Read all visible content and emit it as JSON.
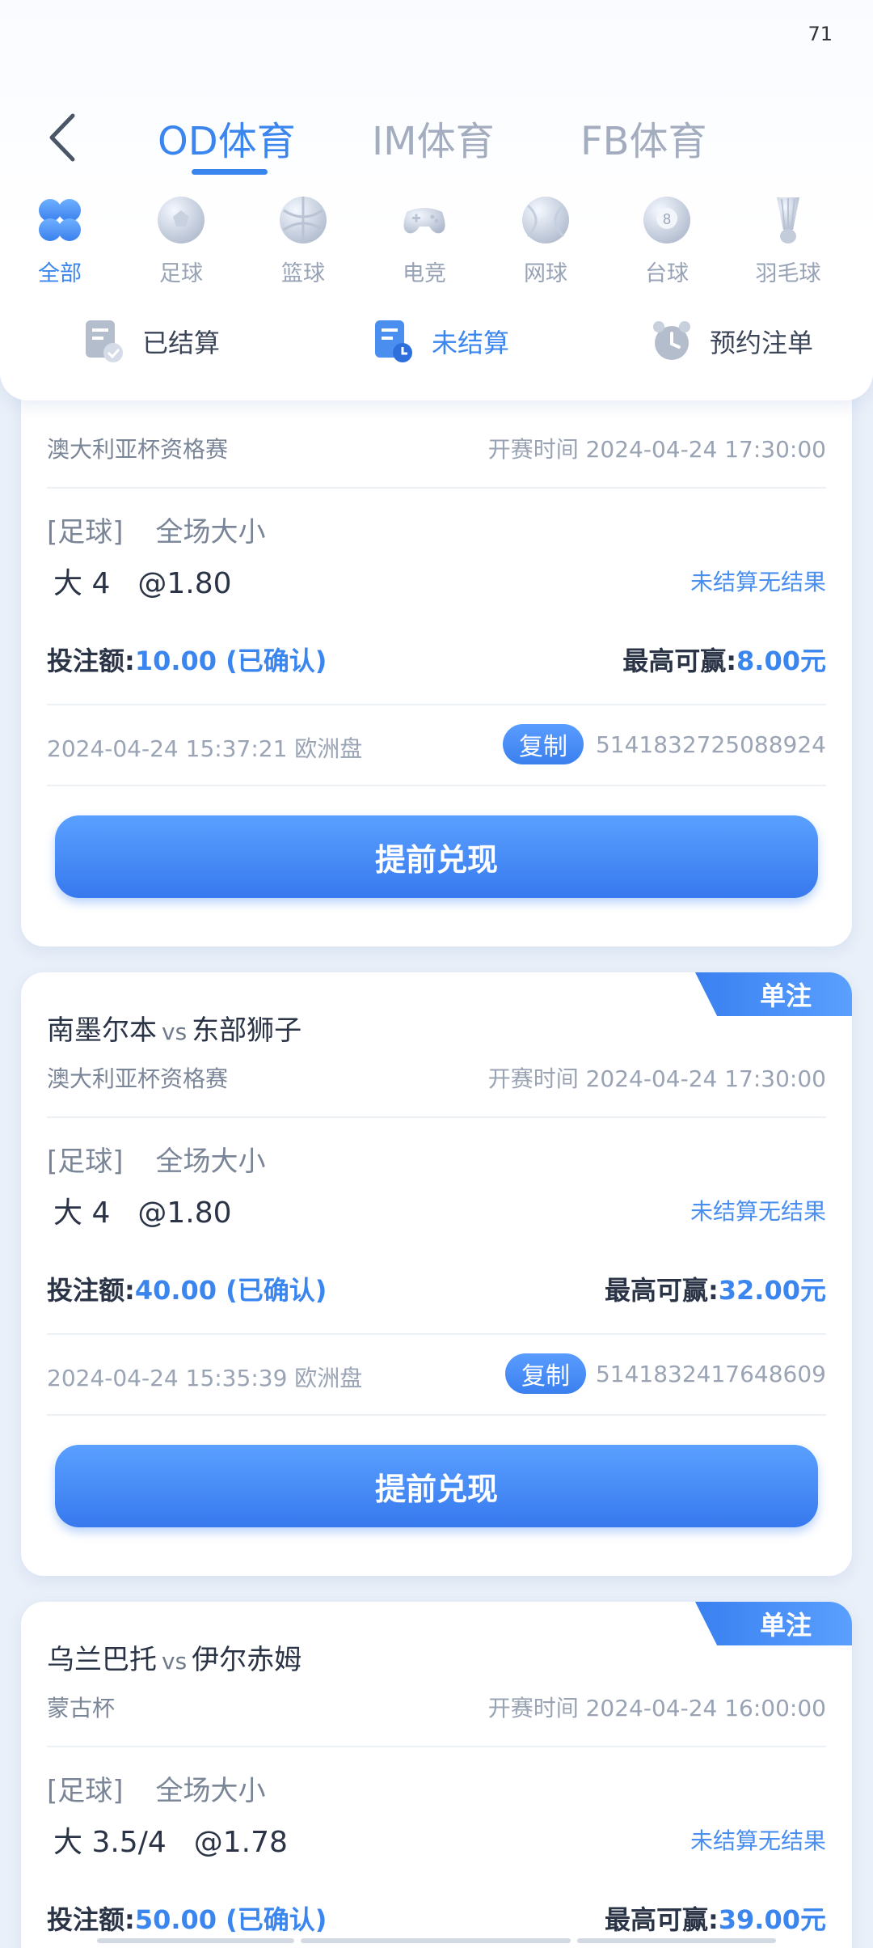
{
  "status_bar": {
    "number": "71"
  },
  "tabs": [
    {
      "label": "OD体育",
      "active": true
    },
    {
      "label": "IM体育",
      "active": false
    },
    {
      "label": "FB体育",
      "active": false
    }
  ],
  "sports": [
    {
      "label": "全部",
      "icon": "all-icon",
      "active": true
    },
    {
      "label": "足球",
      "icon": "football-icon",
      "active": false
    },
    {
      "label": "篮球",
      "icon": "basketball-icon",
      "active": false
    },
    {
      "label": "电竞",
      "icon": "gamepad-icon",
      "active": false
    },
    {
      "label": "网球",
      "icon": "tennis-icon",
      "active": false
    },
    {
      "label": "台球",
      "icon": "billiards-icon",
      "active": false
    },
    {
      "label": "羽毛球",
      "icon": "shuttlecock-icon",
      "active": false
    }
  ],
  "filters": [
    {
      "label": "已结算",
      "icon": "settled-icon",
      "active": false
    },
    {
      "label": "未结算",
      "icon": "unsettled-icon",
      "active": true
    },
    {
      "label": "预约注单",
      "icon": "alarm-clock-icon",
      "active": false
    }
  ],
  "bets": [
    {
      "badge": "",
      "home": "",
      "vs": "",
      "away": "",
      "league": "澳大利亚杯资格赛",
      "start_label": "开赛时间",
      "start_time": "2024-04-24 17:30:00",
      "sport_tag": "[足球]",
      "market": "全场大小",
      "selection": "大 4",
      "odds": "@1.80",
      "result": "未结算无结果",
      "stake_label": "投注额:",
      "stake": "10.00 (已确认)",
      "maxwin_label": "最高可赢:",
      "maxwin": "8.00元",
      "bet_time": "2024-04-24 15:37:21",
      "market_type": "欧洲盘",
      "copy_label": "复制",
      "order_no": "5141832725088924",
      "cashout_label": "提前兑现"
    },
    {
      "badge": "单注",
      "home": "南墨尔本",
      "vs": "vs",
      "away": "东部狮子",
      "league": "澳大利亚杯资格赛",
      "start_label": "开赛时间",
      "start_time": "2024-04-24 17:30:00",
      "sport_tag": "[足球]",
      "market": "全场大小",
      "selection": "大 4",
      "odds": "@1.80",
      "result": "未结算无结果",
      "stake_label": "投注额:",
      "stake": "40.00 (已确认)",
      "maxwin_label": "最高可赢:",
      "maxwin": "32.00元",
      "bet_time": "2024-04-24 15:35:39",
      "market_type": "欧洲盘",
      "copy_label": "复制",
      "order_no": "5141832417648609",
      "cashout_label": "提前兑现"
    },
    {
      "badge": "单注",
      "home": "乌兰巴托",
      "vs": "vs",
      "away": "伊尔赤姆",
      "league": "蒙古杯",
      "start_label": "开赛时间",
      "start_time": "2024-04-24 16:00:00",
      "sport_tag": "[足球]",
      "market": "全场大小",
      "selection": "大 3.5/4",
      "odds": "@1.78",
      "result": "未结算无结果",
      "stake_label": "投注额:",
      "stake": "50.00 (已确认)",
      "maxwin_label": "最高可赢:",
      "maxwin": "39.00元"
    }
  ],
  "colors": {
    "accent": "#3b86ee",
    "background": "#eaf0f9",
    "muted": "#98a3b6"
  }
}
